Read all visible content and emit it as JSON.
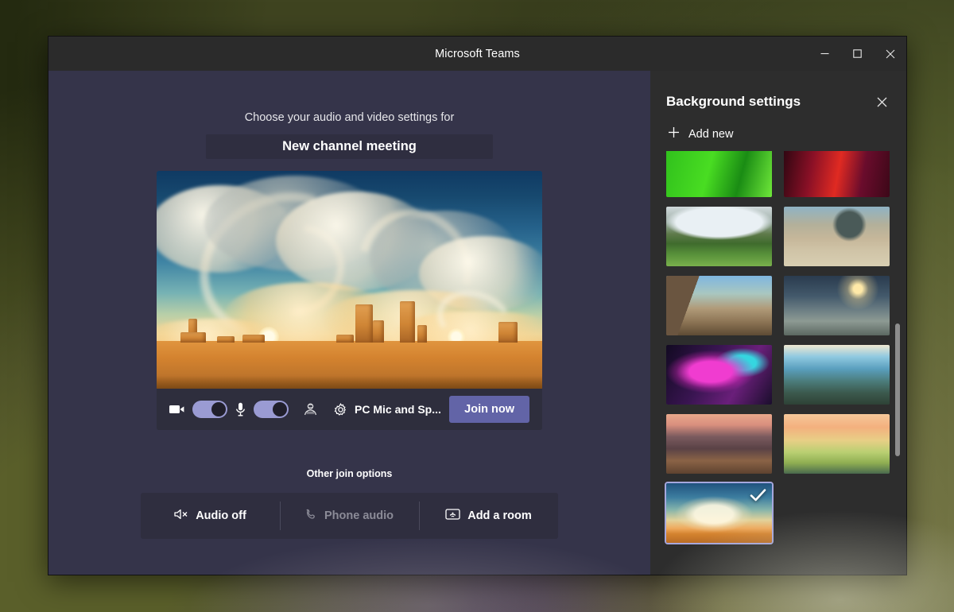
{
  "window": {
    "title": "Microsoft Teams",
    "minimize_label": "Minimize",
    "maximize_label": "Maximize",
    "close_label": "Close"
  },
  "prejoin": {
    "subtitle": "Choose your audio and video settings for",
    "meeting_title": "New channel meeting",
    "controls": {
      "camera_icon": "camera-icon",
      "camera_toggle_on": true,
      "mic_icon": "microphone-icon",
      "mic_toggle_on": true,
      "background_effects_icon": "background-effects-icon",
      "device_settings_icon": "gear-icon",
      "device_label": "PC Mic and Sp...",
      "join_label": "Join now",
      "join_button_color": "#6264a7",
      "toggle_on_color": "#9a9bd3"
    },
    "other_join_options_label": "Other join options",
    "join_options": [
      {
        "label": "Audio off",
        "icon": "speaker-mute-icon",
        "disabled": false
      },
      {
        "label": "Phone audio",
        "icon": "phone-icon",
        "disabled": true
      },
      {
        "label": "Add a room",
        "icon": "room-cast-icon",
        "disabled": false
      }
    ]
  },
  "background_panel": {
    "title": "Background settings",
    "close_icon": "close-icon",
    "add_new_label": "Add new",
    "add_new_icon": "plus-icon",
    "selected_index": 10,
    "selected_check_icon": "check-icon",
    "selection_border_color": "#a6a7dd",
    "thumbnails": [
      {
        "name": "green-field-clipped",
        "art": "art-green",
        "selected": false,
        "clipped": true
      },
      {
        "name": "red-dark-clipped",
        "art": "art-red",
        "selected": false,
        "clipped": true
      },
      {
        "name": "mountain-valley",
        "art": "art-valley",
        "selected": false,
        "clipped": false
      },
      {
        "name": "desert-arch-ruins",
        "art": "art-arch",
        "selected": false,
        "clipped": false
      },
      {
        "name": "medieval-village",
        "art": "art-village",
        "selected": false,
        "clipped": false
      },
      {
        "name": "alien-ice-world",
        "art": "art-space",
        "selected": false,
        "clipped": false
      },
      {
        "name": "pink-nebula",
        "art": "art-nebula",
        "selected": false,
        "clipped": false
      },
      {
        "name": "coastal-cliff-tree",
        "art": "art-cliff",
        "selected": false,
        "clipped": false
      },
      {
        "name": "autumn-street",
        "art": "art-street",
        "selected": false,
        "clipped": false
      },
      {
        "name": "sunset-hillside",
        "art": "art-hill",
        "selected": false,
        "clipped": false
      },
      {
        "name": "desert-swirl-sky",
        "art": "art-desert",
        "selected": true,
        "clipped": false
      }
    ]
  }
}
